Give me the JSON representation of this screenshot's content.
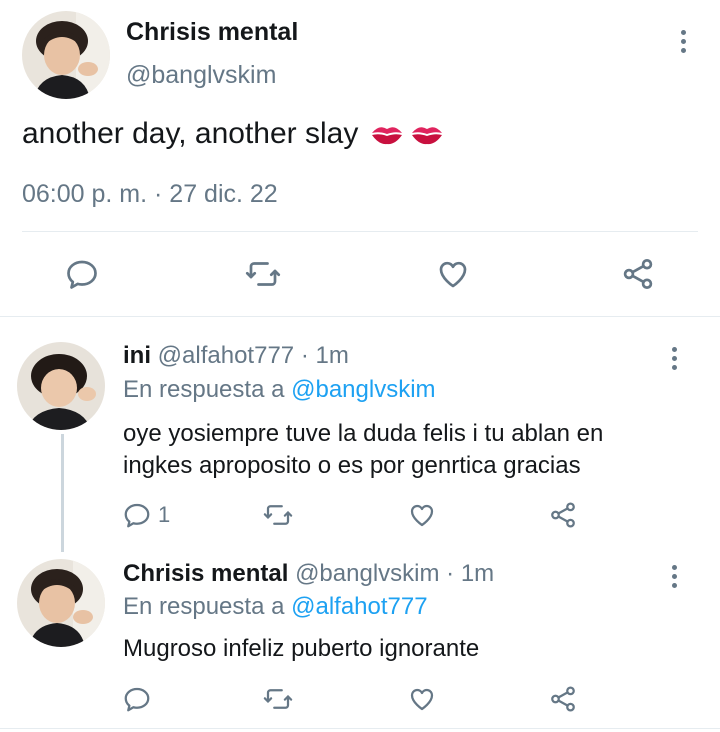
{
  "main_tweet": {
    "display_name": "Chrisis mental",
    "handle": "@banglvskim",
    "text": "another day, another slay",
    "emoji": "💋💋",
    "timestamp": "06:00 p. m. · 27 dic. 22",
    "actions": [
      "reply-icon",
      "retweet-icon",
      "like-icon",
      "share-icon"
    ]
  },
  "replies": [
    {
      "display_name": "ini",
      "handle": "@alfahot777",
      "time": "· 1m",
      "in_reply_prefix": "En respuesta a",
      "in_reply_handle": "@banglvskim",
      "text_line1": "oye yosiempre tuve la duda felis i tu ablan en",
      "text_line2": "ingkes aproposito o es por genrtica gracias",
      "reply_count": "1"
    },
    {
      "display_name": "Chrisis mental",
      "handle": "@banglvskim",
      "time": "· 1m",
      "in_reply_prefix": "En respuesta a",
      "in_reply_handle": "@alfahot777",
      "text_line1": "Mugroso infeliz puberto ignorante",
      "reply_count": ""
    }
  ],
  "colors": {
    "accent": "#1da1f2",
    "muted": "#657786",
    "divider": "#e6ecf0",
    "lips": "#e0245e"
  }
}
